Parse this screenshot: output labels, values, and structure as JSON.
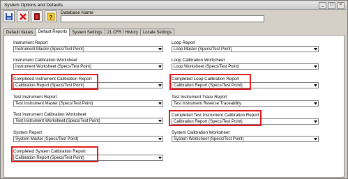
{
  "window": {
    "title": "System Options and Defaults",
    "controls": [
      "_",
      "□",
      "×"
    ]
  },
  "toolbar": {
    "tools": [
      {
        "name": "save-icon"
      },
      {
        "name": "delete-icon"
      },
      {
        "name": "exit-icon"
      },
      {
        "name": "help-icon"
      }
    ]
  },
  "database": {
    "label": "Database Name",
    "value": ""
  },
  "tabs": [
    {
      "label": "Default Values",
      "active": false
    },
    {
      "label": "Default Reports",
      "active": true
    },
    {
      "label": "System Settings",
      "active": false
    },
    {
      "label": "21 CFR / History",
      "active": false
    },
    {
      "label": "Locale Settings",
      "active": false
    }
  ],
  "reports": {
    "left": [
      {
        "label": "Instrument Report",
        "value": "Instrument Master (Specs/Test Point)",
        "highlighted": false
      },
      {
        "label": "Instrument Calibration Worksheet",
        "value": "Instrument Worksheet (Specs/Test Point)",
        "highlighted": false
      },
      {
        "label": "Completed Instrument Calibration Report",
        "value": "Calibration Report (Specs/Test Point)",
        "highlighted": true
      },
      {
        "label": "Test Instrument Report",
        "value": "Test Instrument Master (Specs/Test Point)",
        "highlighted": false
      },
      {
        "label": "Test Instrument Calibration Worksheet",
        "value": "Test Instrument Worksheet (Specs/Test Point)",
        "highlighted": false
      },
      {
        "label": "System Report",
        "value": "System Master (Specs/Test Point)",
        "highlighted": false
      },
      {
        "label": "Completed System Calibration Report",
        "value": "Calibration Report (Specs/Test Point)",
        "highlighted": true
      }
    ],
    "right": [
      {
        "label": "Loop Report",
        "value": "Loop Master (Specs/Test Point)",
        "highlighted": false
      },
      {
        "label": "Loop Calibration Worksheet",
        "value": "Loop Worksheet (Specs/Test Point)",
        "highlighted": false
      },
      {
        "label": "Completed Loop Calibration Report",
        "value": "Calibration Report (Specs/Test Point)",
        "highlighted": true
      },
      {
        "label": "Test Instrument Trace Report",
        "value": "Test Instrument Reverse Traceability",
        "highlighted": false
      },
      {
        "label": "Completed Test Instrument Calibration Report",
        "value": "Calibration Report (Specs/Test Point)",
        "highlighted": true
      },
      {
        "label": "System Calibration Worksheet",
        "value": "System Worksheet (Specs/Test Point)",
        "highlighted": false
      }
    ]
  },
  "colors": {
    "highlight": "#e01a1a",
    "window_bg": "#d4d0c8"
  }
}
